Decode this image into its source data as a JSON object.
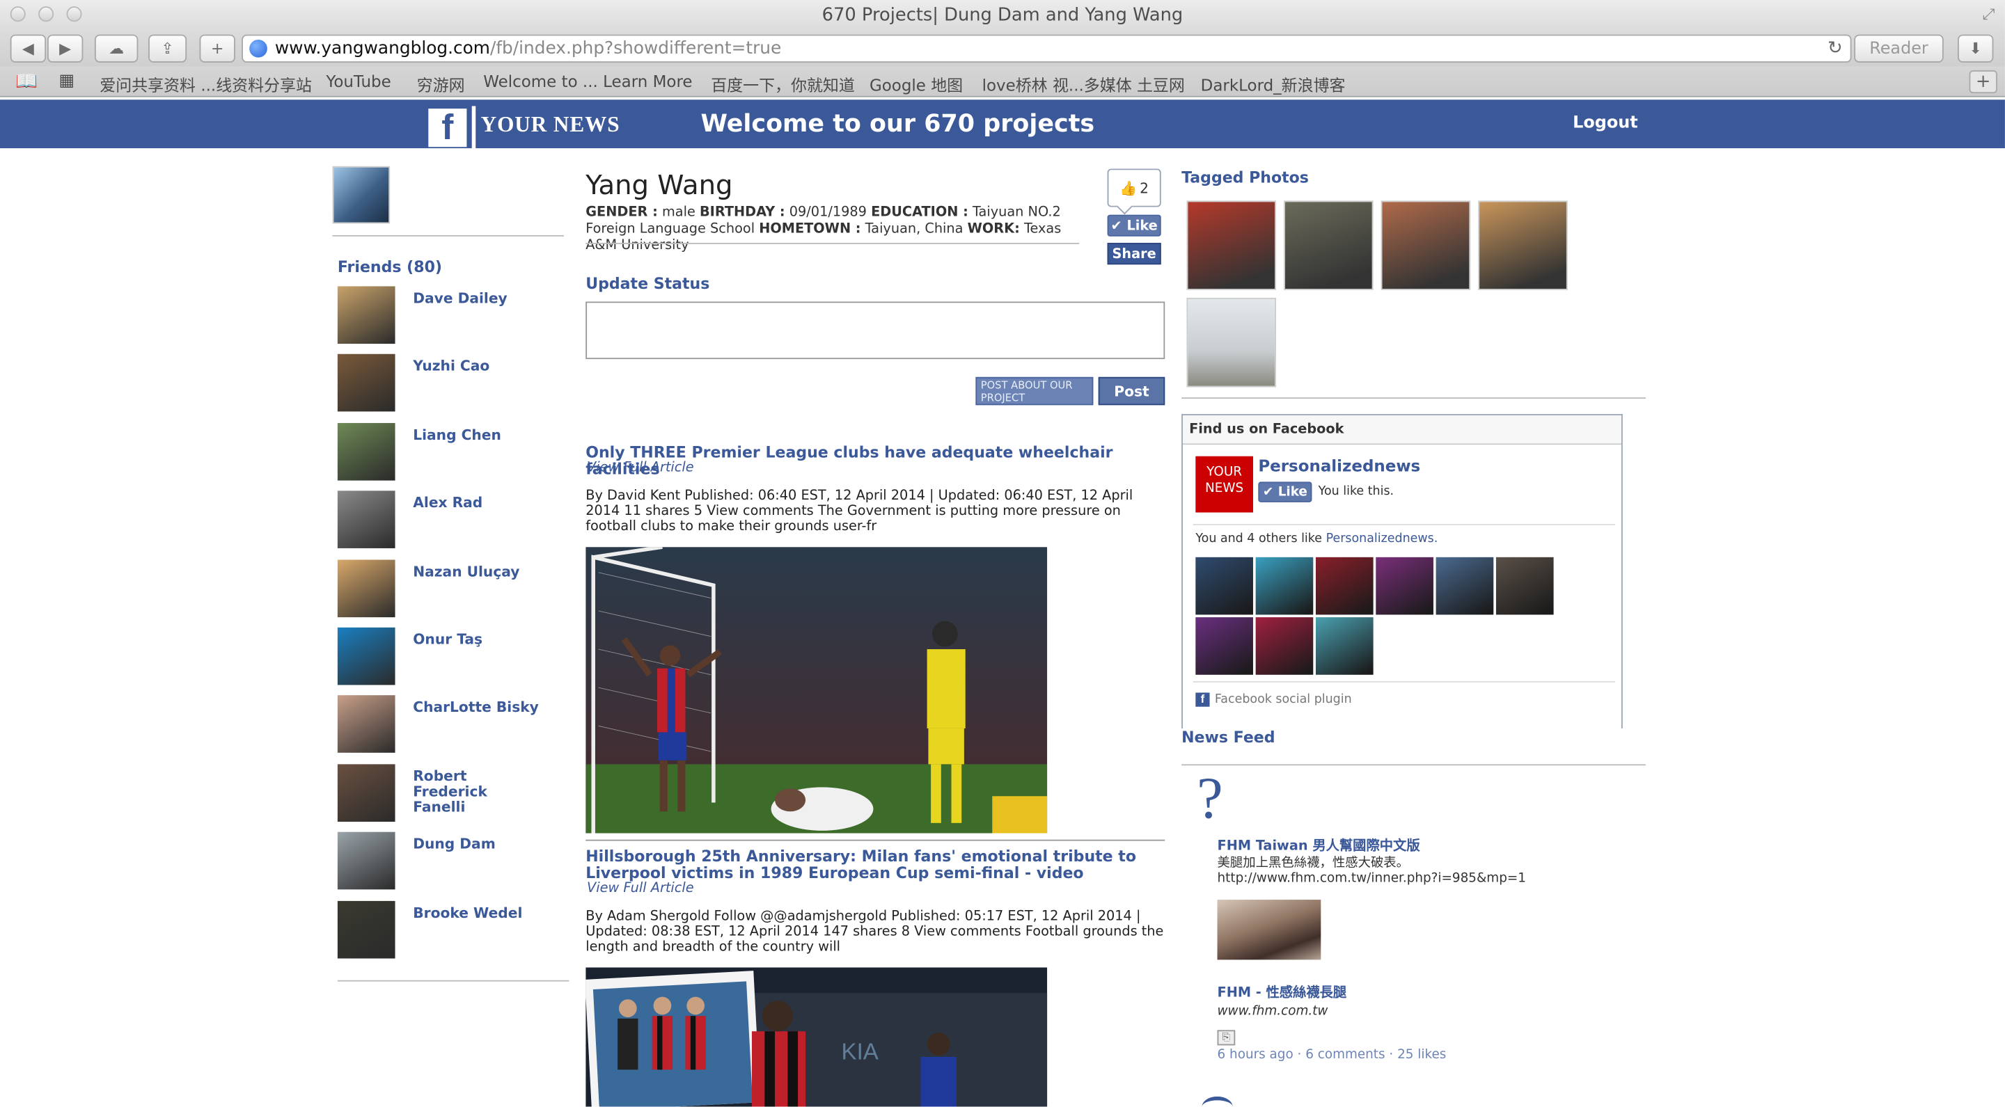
{
  "browser": {
    "window_title": "670 Projects| Dung Dam and Yang Wang",
    "url_host": "www.yangwangblog.com",
    "url_path": "/fb/index.php?showdifferent=true",
    "reader_label": "Reader",
    "bookmarks": [
      "爱问共享资料 ...线资料分享站",
      "YouTube",
      "穷游网",
      "Welcome to ... Learn More",
      "百度一下，你就知道",
      "Google 地图",
      "love桥林 视...多媒体 土豆网",
      "DarkLord_新浪博客"
    ]
  },
  "header": {
    "logo_letter": "f",
    "logo_text": "YOUR NEWS",
    "title": "Welcome to our 670 projects",
    "logout": "Logout"
  },
  "profile": {
    "name": "Yang Wang",
    "gender_label": "GENDER :",
    "gender": "male",
    "birthday_label": "BIRTHDAY :",
    "birthday": "09/01/1989",
    "education_label": "EDUCATION :",
    "education": "Taiyuan NO.2 Foreign Language School",
    "hometown_label": "HOMETOWN :",
    "hometown": "Taiyuan, China",
    "work_label": "WORK:",
    "work": "Texas A&M University",
    "like_count": "2",
    "like_label": "Like",
    "share_label": "Share"
  },
  "friends": {
    "title": "Friends (80)",
    "list": [
      {
        "name": "Dave Dailey",
        "color": "#c9a36a"
      },
      {
        "name": "Yuzhi Cao",
        "color": "#7a5a3a"
      },
      {
        "name": "Liang Chen",
        "color": "#6e8a55"
      },
      {
        "name": "Alex Rad",
        "color": "#8a8a8a"
      },
      {
        "name": "Nazan Uluçay",
        "color": "#d9a86a"
      },
      {
        "name": "Onur Taş",
        "color": "#1a7fc0"
      },
      {
        "name": "CharLotte Bisky",
        "color": "#c9a08a"
      },
      {
        "name": "Robert Frederick Fanelli",
        "color": "#6a5040"
      },
      {
        "name": "Dung Dam",
        "color": "#9aa4aa"
      },
      {
        "name": "Brooke Wedel",
        "color": "#3a3a30"
      }
    ]
  },
  "status": {
    "title": "Update Status",
    "value": "",
    "post_about_label": "POST ABOUT OUR PROJECT",
    "post_label": "Post"
  },
  "articles": [
    {
      "title": "Only THREE Premier League clubs have adequate wheelchair facilities",
      "link": "View Full Article",
      "text": "By David Kent Published: 06:40 EST, 12 April 2014 | Updated: 06:40 EST, 12 April 2014 11 shares 5 View comments The Government is putting more pressure on football clubs to make their grounds user-fr"
    },
    {
      "title": "Hillsborough 25th Anniversary: Milan fans' emotional tribute to Liverpool victims in 1989 European Cup semi-final - video",
      "link": "View Full Article",
      "text": "By Adam Shergold Follow @@adamjshergold Published: 05:17 EST, 12 April 2014 | Updated: 08:38 EST, 12 April 2014 147 shares 8 View comments Football grounds the length and breadth of the country will"
    }
  ],
  "tagged": {
    "title": "Tagged Photos",
    "photos": [
      "#b5392a",
      "#6b6b5a",
      "#b06a4a",
      "#c9955a",
      "#c8cdd0"
    ]
  },
  "plugin": {
    "header": "Find us on Facebook",
    "logo_text": "YOUR NEWS",
    "page_name": "Personalizednews",
    "like_label": "Like",
    "you_like": "You like this.",
    "others_prefix": "You and 4 others like",
    "others_link": "Personalizednews.",
    "fans": [
      "#2f4c70",
      "#3aa0c0",
      "#8a1f2a",
      "#7a2f7a",
      "#4a6a90",
      "#5a5048",
      "#6a2f80",
      "#a02040",
      "#4aa0b0"
    ],
    "footer": "Facebook social plugin"
  },
  "newsfeed": {
    "title": "News Feed",
    "item_title": "FHM Taiwan 男人幫國際中文版",
    "item_text": "美腿加上黑色絲襪，性感大破表。 http://www.fhm.com.tw/inner.php?i=985&mp=1",
    "link_title": "FHM - 性感絲襪長腿",
    "link_domain": "www.fhm.com.tw",
    "meta": "6 hours ago · 6 comments · 25 likes"
  }
}
